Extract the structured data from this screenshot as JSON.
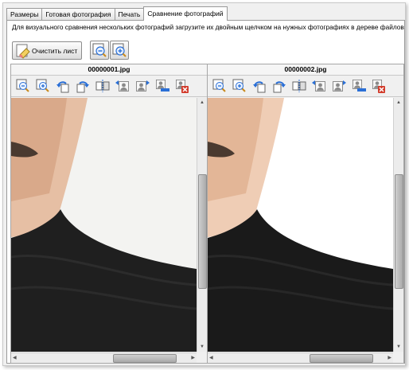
{
  "tabs": [
    {
      "label": "Размеры",
      "active": false
    },
    {
      "label": "Готовая фотография",
      "active": false
    },
    {
      "label": "Печать",
      "active": false
    },
    {
      "label": "Сравнение фотографий",
      "active": true
    }
  ],
  "instruction": "Для визуального сравнения нескольких фотографий загрузите их двойным щелчком на нужных фотографиях в дереве файлов",
  "toolbar": {
    "clear_label": "Очистить лист",
    "clear_icon": "eraser-icon",
    "zoom_out_all_icon": "zoom-out-all-icon",
    "zoom_in_all_icon": "zoom-in-all-icon"
  },
  "panes": [
    {
      "filename": "00000001.jpg"
    },
    {
      "filename": "00000002.jpg"
    }
  ],
  "pane_tools": [
    "zoom-out-icon",
    "zoom-in-icon",
    "rotate-left-icon",
    "rotate-right-icon",
    "mirror-icon",
    "move-left-icon",
    "move-right-icon",
    "remove-icon",
    "delete-icon"
  ],
  "colors": {
    "accent": "#2a6fd6",
    "delete": "#d23a2a",
    "sweater": "#1c1c1c",
    "skin": "#e8c4a7"
  }
}
